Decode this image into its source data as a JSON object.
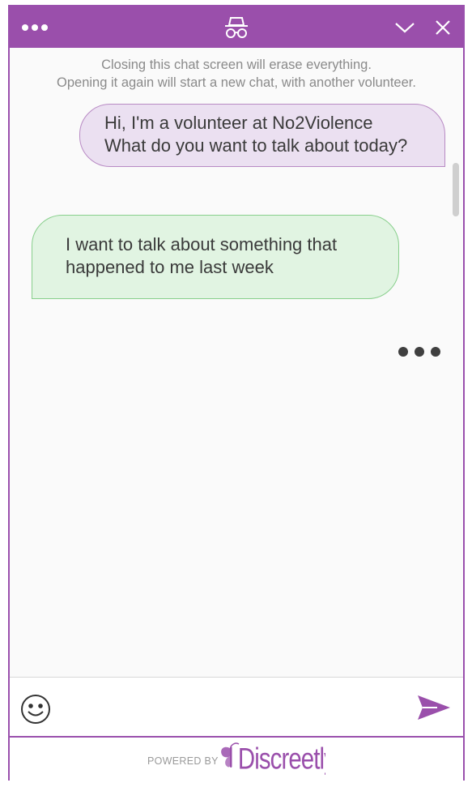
{
  "header": {
    "menu_icon": "more-dots-icon",
    "incognito_icon": "incognito-icon",
    "minimize_icon": "chevron-down-icon",
    "close_icon": "close-icon",
    "background_color": "#9a4fab"
  },
  "notice": {
    "line1": "Closing this chat screen will erase everything.",
    "line2": "Opening it again will start a new chat, with another volunteer."
  },
  "messages": [
    {
      "sender": "volunteer",
      "lines": [
        "Hi, I'm a volunteer at No2Violence",
        "What do you want to talk about today?"
      ],
      "color": "#ebe0f1"
    },
    {
      "sender": "user",
      "lines": [
        "I want to talk about something that",
        "happened to me last week"
      ],
      "color": "#e1f4e2"
    }
  ],
  "typing_indicator": "typing-dots-icon",
  "composer": {
    "emoji_icon": "smiley-icon",
    "input_value": "",
    "send_icon": "send-icon",
    "accent": "#9a4fab"
  },
  "footer": {
    "powered_by": "POWERED BY",
    "brand": "Discreetly",
    "brand_color": "#9a4fab"
  }
}
